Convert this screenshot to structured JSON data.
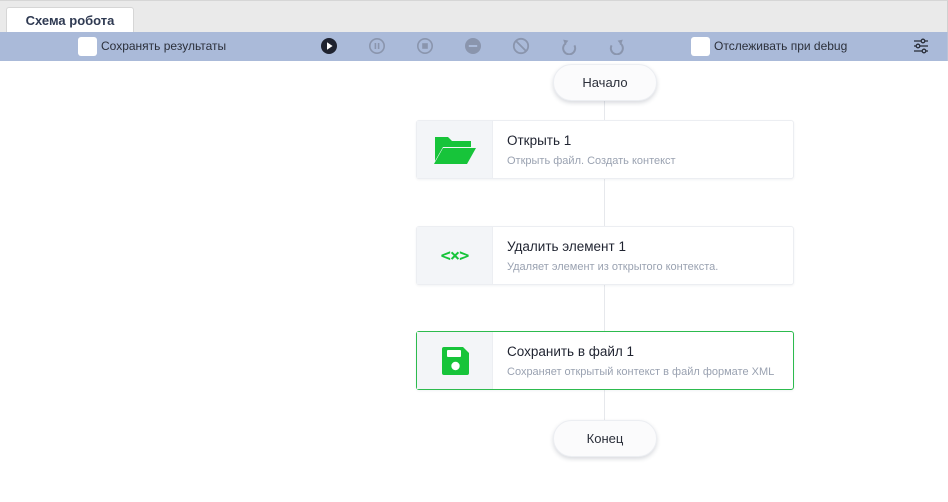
{
  "tab": {
    "label": "Схема робота"
  },
  "toolbar": {
    "save_results_label": "Сохранять результаты",
    "track_debug_label": "Отслеживать при debug"
  },
  "colors": {
    "toolbar_bg": "#aabad9",
    "accent_green": "#17c43a",
    "selected_border": "#2dbb4e",
    "play_enabled": "#1f2330",
    "control_disabled": "#8a95ad"
  },
  "flow": {
    "start_label": "Начало",
    "end_label": "Конец",
    "nodes": [
      {
        "title": "Открыть  1",
        "desc": "Открыть файл. Создать контекст",
        "icon": "folder-open-icon"
      },
      {
        "title": "Удалить элемент  1",
        "desc": "Удаляет элемент из открытого контекста.",
        "icon": "code-x-icon"
      },
      {
        "title": "Сохранить в файл  1",
        "desc": "Сохраняет открытый контекст в файл формате XML",
        "icon": "save-icon"
      }
    ]
  }
}
